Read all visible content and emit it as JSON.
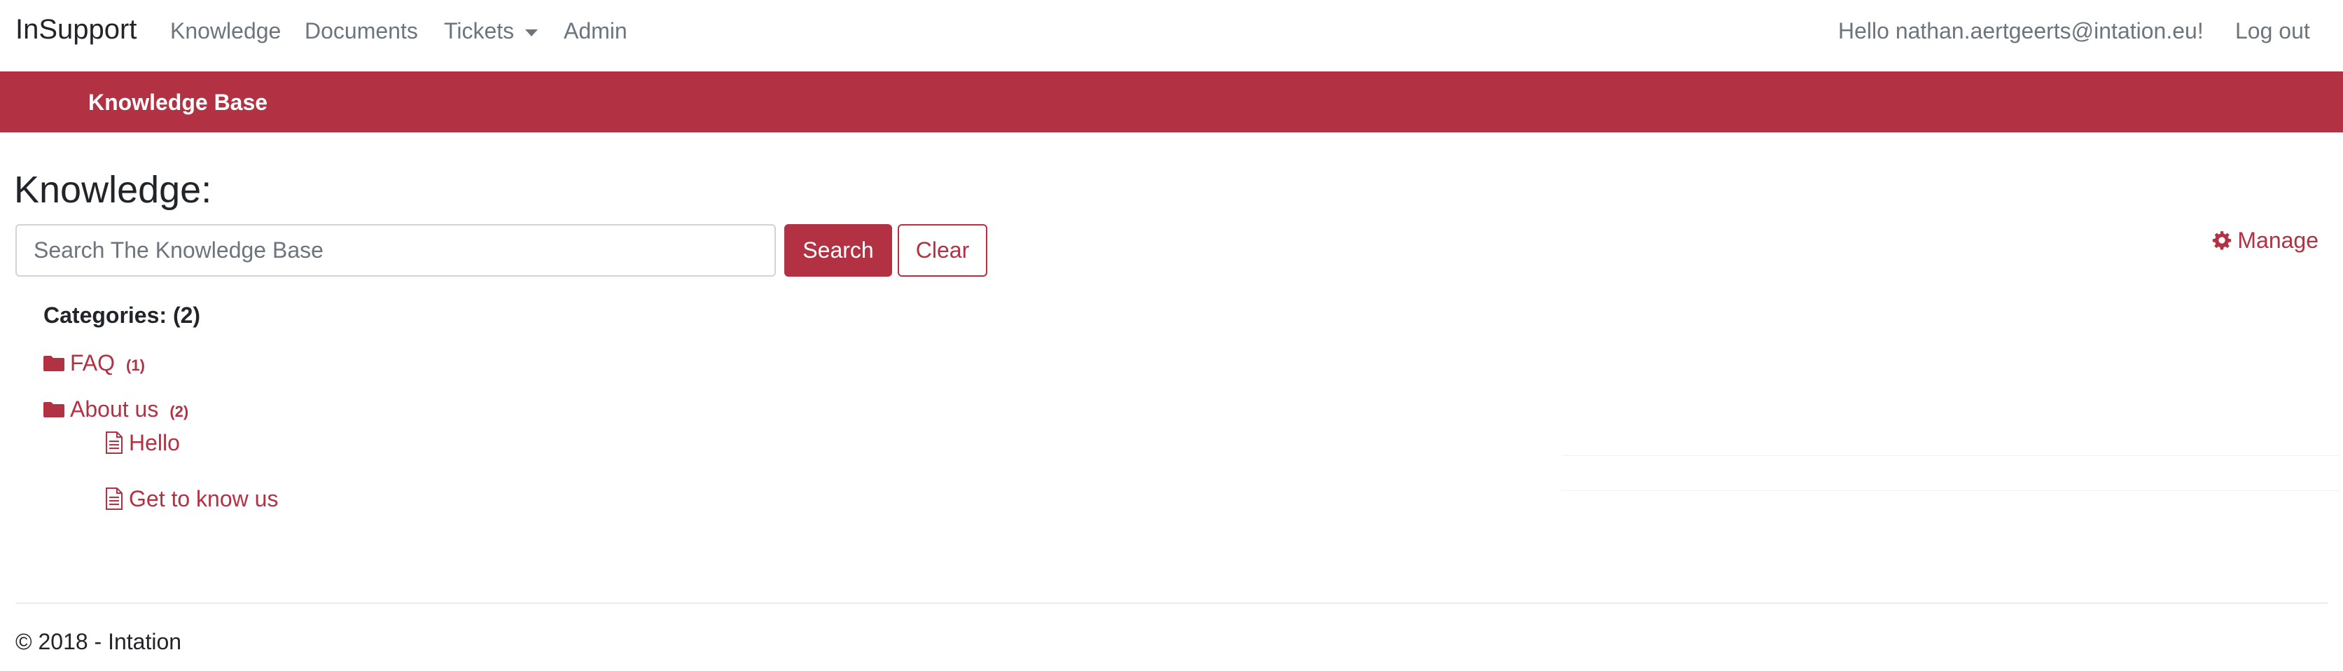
{
  "navbar": {
    "brand": "InSupport",
    "links": [
      "Knowledge",
      "Documents",
      "Tickets",
      "Admin"
    ],
    "greeting": "Hello nathan.aertgeerts@intation.eu!",
    "logout": "Log out"
  },
  "subbar": {
    "title": "Knowledge Base"
  },
  "main": {
    "title": "Knowledge:",
    "search": {
      "placeholder": "Search The Knowledge Base",
      "value": ""
    },
    "search_button": "Search",
    "clear_button": "Clear",
    "manage": "Manage",
    "categories_header": "Categories: (2)",
    "categories": [
      {
        "name": "FAQ",
        "count": "(1)"
      },
      {
        "name": "About us",
        "count": "(2)"
      }
    ],
    "articles": [
      "Hello",
      "Get to know us"
    ]
  },
  "footer": {
    "text": "© 2018 - Intation"
  },
  "colors": {
    "accent": "#b23244",
    "text": "#212529",
    "muted": "#6c757d"
  },
  "icons": {
    "manage": "gear-icon",
    "category": "folder-icon",
    "article": "file-text-icon",
    "dropdown": "caret-down-icon"
  }
}
